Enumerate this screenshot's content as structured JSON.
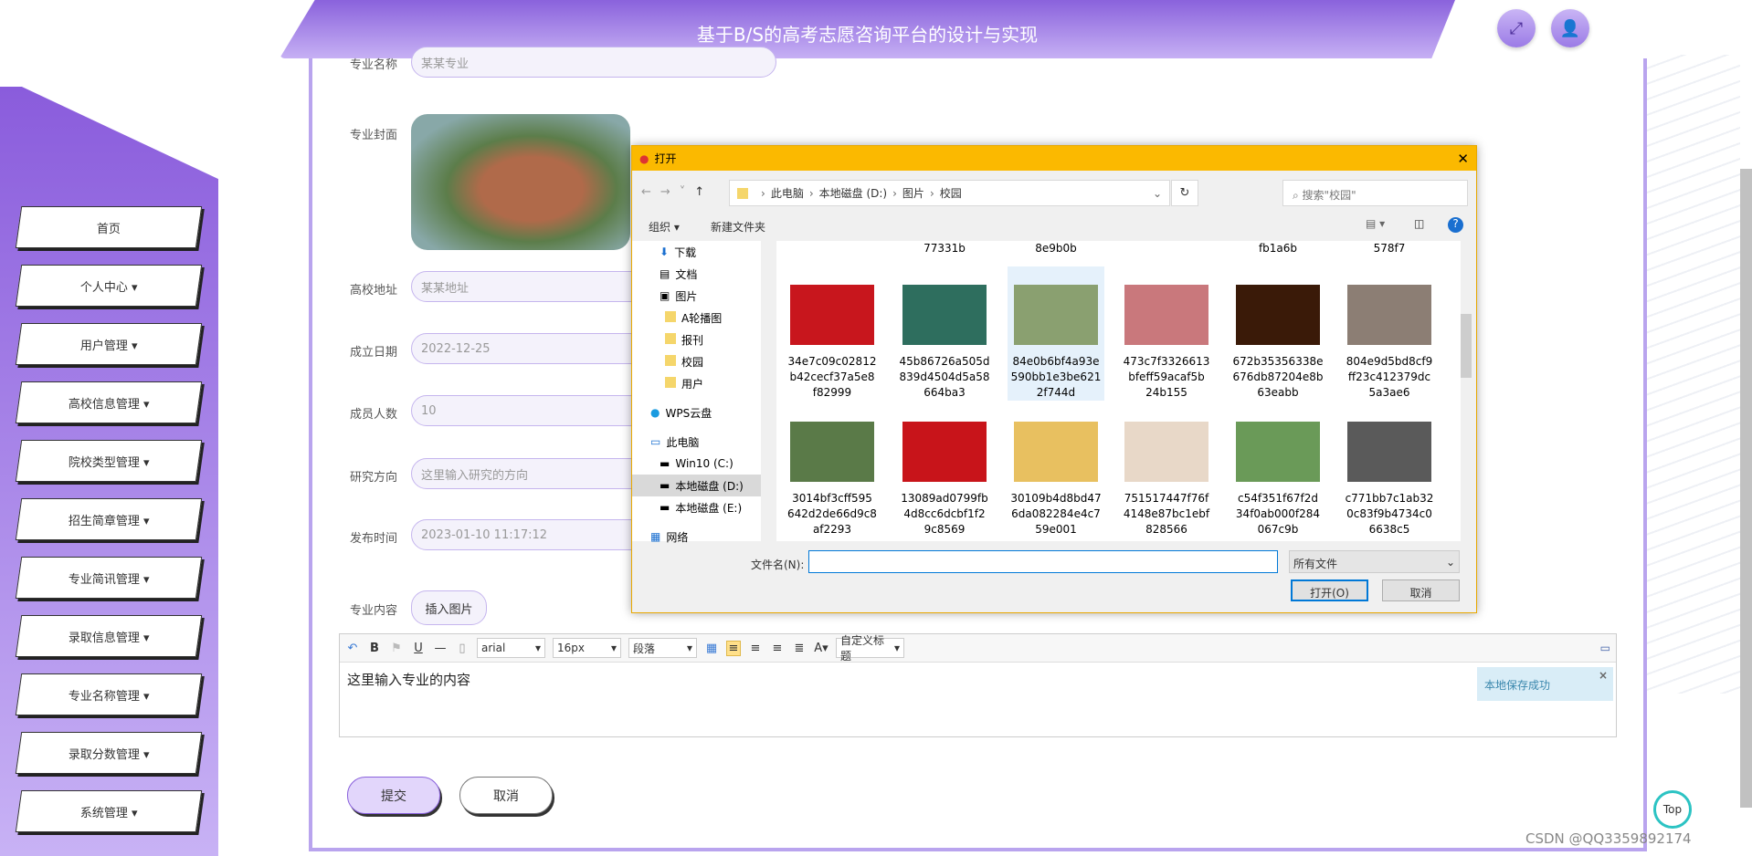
{
  "header": {
    "title": "基于B/S的高考志愿咨询平台的设计与实现",
    "icons": [
      "fullscreen-icon",
      "user-icon"
    ]
  },
  "sidebar": {
    "items": [
      "首页",
      "个人中心 ▾",
      "用户管理 ▾",
      "高校信息管理 ▾",
      "院校类型管理 ▾",
      "招生简章管理 ▾",
      "专业简讯管理 ▾",
      "录取信息管理 ▾",
      "专业名称管理 ▾",
      "录取分数管理 ▾",
      "系统管理 ▾"
    ]
  },
  "form": {
    "name_label": "专业名称",
    "name_value": "某某专业",
    "cover_label": "专业封面",
    "address_label": "高校地址",
    "address_value": "某某地址",
    "date_label": "成立日期",
    "date_value": "2022-12-25",
    "members_label": "成员人数",
    "members_value": "10",
    "research_label": "研究方向",
    "research_placeholder": "这里输入研究的方向",
    "publish_label": "发布时间",
    "publish_value": "2023-01-10 11:17:12",
    "content_label": "专业内容",
    "insert_image": "插入图片",
    "submit": "提交",
    "cancel": "取消"
  },
  "editor": {
    "font": "arial",
    "size": "16px",
    "paragraph": "段落",
    "custom_title": "自定义标题",
    "content": "这里输入专业的内容",
    "toast": "本地保存成功"
  },
  "dialog": {
    "title": "打开",
    "breadcrumb": [
      "此电脑",
      "本地磁盘 (D:)",
      "图片",
      "校园"
    ],
    "search_placeholder": "搜索\"校园\"",
    "organize": "组织 ▾",
    "new_folder": "新建文件夹",
    "nav": [
      "下载",
      "文档",
      "图片",
      "A轮播图",
      "报刊",
      "校园",
      "用户",
      "WPS云盘",
      "此电脑",
      "Win10 (C:)",
      "本地磁盘 (D:)",
      "本地磁盘 (E:)",
      "网络"
    ],
    "top_row": [
      "77331b",
      "8e9b0b",
      "",
      "fb1a6b",
      "578f7"
    ],
    "files": [
      {
        "name": "34e7c09c02812b42cecf37a5e8f82999",
        "color": "#c8161d"
      },
      {
        "name": "45b86726a505d839d4504d5a58664ba3",
        "color": "#2e6e5e"
      },
      {
        "name": "84e0b6bf4a93e590bb1e3be6212f744d",
        "color": "#8aa070"
      },
      {
        "name": "473c7f3326613bfeff59acaf5b24b155",
        "color": "#c9787c"
      },
      {
        "name": "672b35356338e676db87204e8b63eabb",
        "color": "#3a1a08"
      },
      {
        "name": "804e9d5bd8cf9ff23c412379dc5a3ae6",
        "color": "#8c7e74"
      },
      {
        "name": "3014bf3cff595642d2de66d9c8af2293",
        "color": "#5a7a48"
      },
      {
        "name": "13089ad0799fb4d8cc6dcbf1f29c8569",
        "color": "#c8141a"
      },
      {
        "name": "30109b4d8bd476da082284e4c759e001",
        "color": "#e8c060"
      },
      {
        "name": "751517447f76f4148e87bc1ebf828566",
        "color": "#e8d8c8"
      },
      {
        "name": "c54f351f67f2d34f0ab000f284067c9b",
        "color": "#6a9a58"
      },
      {
        "name": "c771bb7c1ab320c83f9b4734c06638c5",
        "color": "#5a5a5a"
      }
    ],
    "filename_label": "文件名(N):",
    "filename_value": "",
    "filetype": "所有文件",
    "open": "打开(O)",
    "cancel": "取消"
  },
  "top_button": "Top",
  "watermark": "CSDN @QQ3359892174"
}
